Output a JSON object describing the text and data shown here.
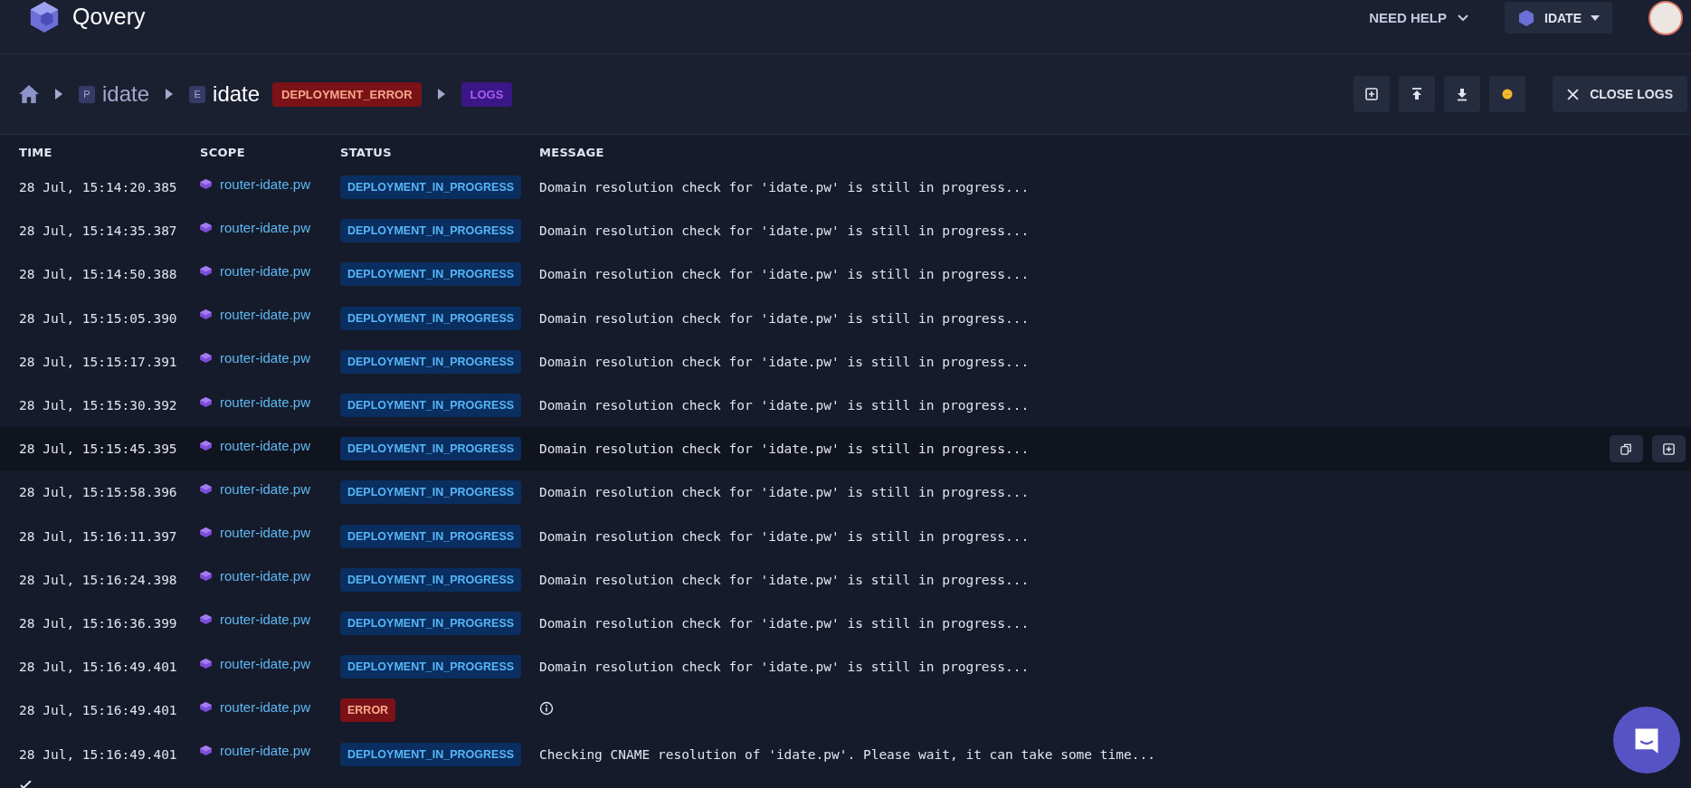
{
  "header": {
    "logo": "Qovery",
    "help": "NEED HELP",
    "organization": "IDATE"
  },
  "breadcrumb": {
    "project_tag": "P",
    "project": "idate",
    "environment_tag": "E",
    "environment": "idate",
    "environment_status": "DEPLOYMENT_ERROR",
    "page": "LOGS"
  },
  "toolbar": {
    "close": "CLOSE LOGS"
  },
  "table": {
    "columns": [
      "TIME",
      "SCOPE",
      "STATUS",
      "MESSAGE"
    ],
    "rows": [
      {
        "time": "28 Jul, 15:14:20.385",
        "scope": "router-idate.pw",
        "status": "DEPLOYMENT_IN_PROGRESS",
        "kind": "progress",
        "message": "Domain resolution check for 'idate.pw' is still in progress...",
        "hovered": false
      },
      {
        "time": "28 Jul, 15:14:35.387",
        "scope": "router-idate.pw",
        "status": "DEPLOYMENT_IN_PROGRESS",
        "kind": "progress",
        "message": "Domain resolution check for 'idate.pw' is still in progress...",
        "hovered": false
      },
      {
        "time": "28 Jul, 15:14:50.388",
        "scope": "router-idate.pw",
        "status": "DEPLOYMENT_IN_PROGRESS",
        "kind": "progress",
        "message": "Domain resolution check for 'idate.pw' is still in progress...",
        "hovered": false
      },
      {
        "time": "28 Jul, 15:15:05.390",
        "scope": "router-idate.pw",
        "status": "DEPLOYMENT_IN_PROGRESS",
        "kind": "progress",
        "message": "Domain resolution check for 'idate.pw' is still in progress...",
        "hovered": false
      },
      {
        "time": "28 Jul, 15:15:17.391",
        "scope": "router-idate.pw",
        "status": "DEPLOYMENT_IN_PROGRESS",
        "kind": "progress",
        "message": "Domain resolution check for 'idate.pw' is still in progress...",
        "hovered": false
      },
      {
        "time": "28 Jul, 15:15:30.392",
        "scope": "router-idate.pw",
        "status": "DEPLOYMENT_IN_PROGRESS",
        "kind": "progress",
        "message": "Domain resolution check for 'idate.pw' is still in progress...",
        "hovered": false
      },
      {
        "time": "28 Jul, 15:15:45.395",
        "scope": "router-idate.pw",
        "status": "DEPLOYMENT_IN_PROGRESS",
        "kind": "progress",
        "message": "Domain resolution check for 'idate.pw' is still in progress...",
        "hovered": true
      },
      {
        "time": "28 Jul, 15:15:58.396",
        "scope": "router-idate.pw",
        "status": "DEPLOYMENT_IN_PROGRESS",
        "kind": "progress",
        "message": "Domain resolution check for 'idate.pw' is still in progress...",
        "hovered": false
      },
      {
        "time": "28 Jul, 15:16:11.397",
        "scope": "router-idate.pw",
        "status": "DEPLOYMENT_IN_PROGRESS",
        "kind": "progress",
        "message": "Domain resolution check for 'idate.pw' is still in progress...",
        "hovered": false
      },
      {
        "time": "28 Jul, 15:16:24.398",
        "scope": "router-idate.pw",
        "status": "DEPLOYMENT_IN_PROGRESS",
        "kind": "progress",
        "message": "Domain resolution check for 'idate.pw' is still in progress...",
        "hovered": false
      },
      {
        "time": "28 Jul, 15:16:36.399",
        "scope": "router-idate.pw",
        "status": "DEPLOYMENT_IN_PROGRESS",
        "kind": "progress",
        "message": "Domain resolution check for 'idate.pw' is still in progress...",
        "hovered": false
      },
      {
        "time": "28 Jul, 15:16:49.401",
        "scope": "router-idate.pw",
        "status": "DEPLOYMENT_IN_PROGRESS",
        "kind": "progress",
        "message": "Domain resolution check for 'idate.pw' is still in progress...",
        "hovered": false
      },
      {
        "time": "28 Jul, 15:16:49.401",
        "scope": "router-idate.pw",
        "status": "ERROR",
        "kind": "error",
        "hovered": false
      },
      {
        "time": "28 Jul, 15:16:49.401",
        "scope": "router-idate.pw",
        "status": "DEPLOYMENT_IN_PROGRESS",
        "kind": "progress",
        "message": "Checking CNAME resolution of 'idate.pw'. Please wait, it can take some time...",
        "hovered": false
      }
    ]
  }
}
